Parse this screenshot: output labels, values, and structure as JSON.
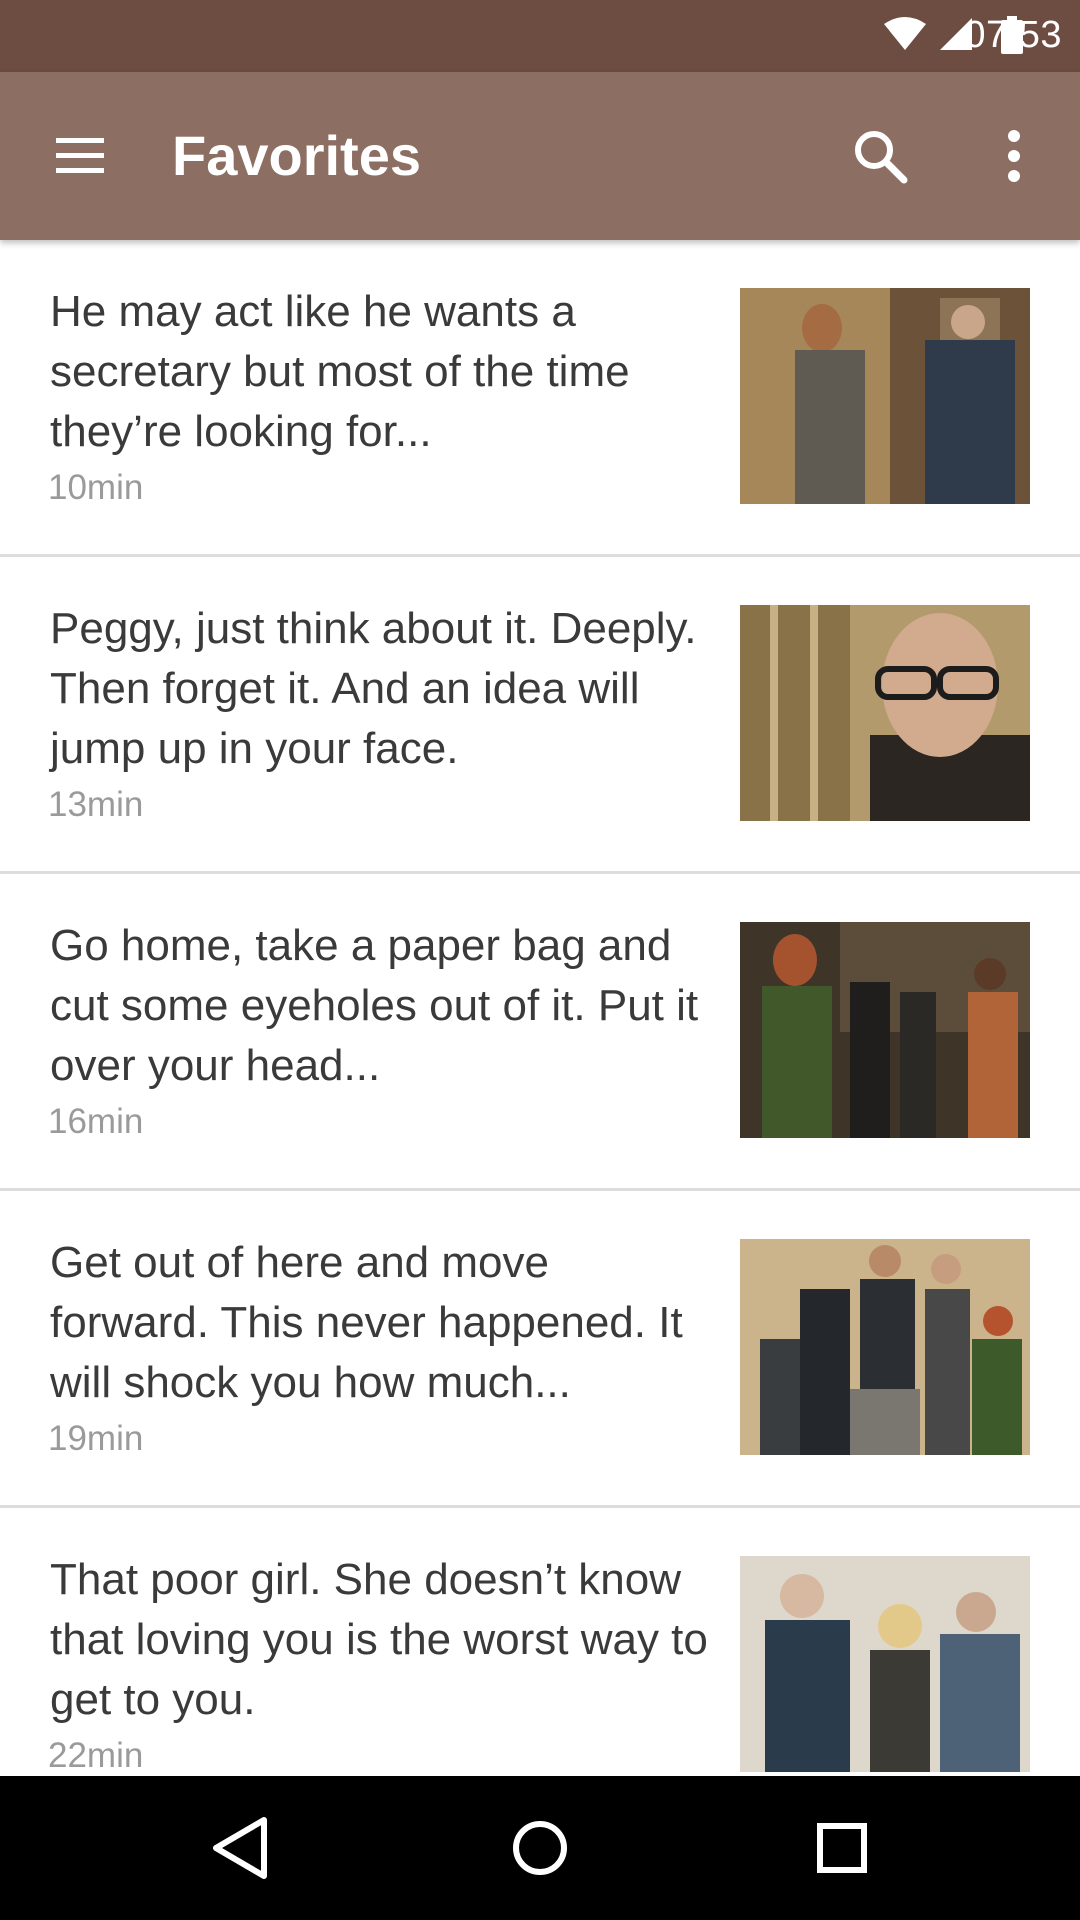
{
  "status_bar": {
    "time": "07:53",
    "icons": [
      "wifi-icon",
      "cell-signal-icon",
      "battery-icon"
    ]
  },
  "app_bar": {
    "title": "Favorites",
    "menu_icon": "hamburger-menu-icon",
    "search_icon": "search-icon",
    "more_icon": "more-vert-icon"
  },
  "items": [
    {
      "quote": "He may act like he wants a secretary but most of the time they’re looking for...",
      "duration": "10min"
    },
    {
      "quote": "Peggy, just think about it. Deeply. Then forget it. And an idea will jump up in your face.",
      "duration": "13min"
    },
    {
      "quote": "Go home, take a paper bag and cut some eyeholes out of it. Put it over your head...",
      "duration": "16min"
    },
    {
      "quote": "Get out of here and move forward. This never happened. It will shock you how much...",
      "duration": "19min"
    },
    {
      "quote": "That poor girl. She doesn’t know that loving you is the worst way to get to you.",
      "duration": "22min"
    }
  ],
  "nav_bar": {
    "icons": [
      "back-icon",
      "home-icon",
      "recents-icon"
    ]
  },
  "colors": {
    "status_bar": "#6d4c41",
    "app_bar": "#8d6e63",
    "text": "#3a3a3a",
    "secondary_text": "#9a9a9a",
    "divider": "#dddddd",
    "nav_bar": "#000000"
  }
}
